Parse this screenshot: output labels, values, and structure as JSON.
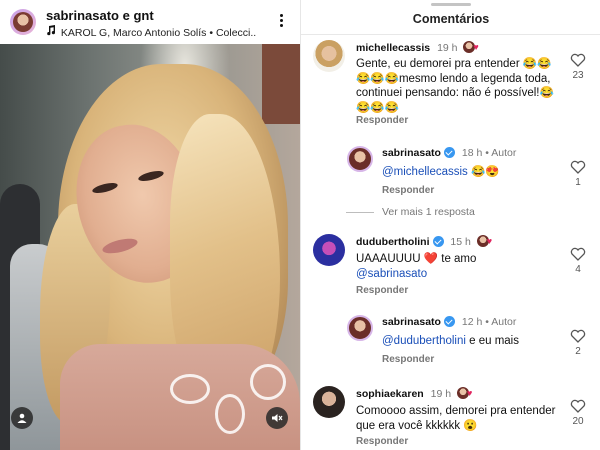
{
  "post": {
    "author": "sabrinasato",
    "conjunction": "e",
    "coauthor": "gnt",
    "music": "KAROL G, Marco Antonio Solís • Colecci..."
  },
  "comments_panel": {
    "title": "Comentários",
    "view_more": "Ver mais 1 resposta",
    "items": [
      {
        "user": "michellecassis",
        "time": "19 h",
        "text": "Gente, eu demorei pra entender 😂😂😂😂😂mesmo lendo a legenda toda, continuei pensando: não é possível!😂😂😂😂",
        "reply_label": "Responder",
        "likes": "23"
      },
      {
        "user": "sabrinasato",
        "time": "18 h",
        "author_tag": "• Autor",
        "mention": "@michellecassis",
        "text": " 😂😍",
        "reply_label": "Responder",
        "likes": "1"
      },
      {
        "user": "dudubertholini",
        "time": "15 h",
        "text": "UAAAUUUU ❤️ te amo",
        "mention": "@sabrinasato",
        "reply_label": "Responder",
        "likes": "4"
      },
      {
        "user": "sabrinasato",
        "time": "12 h",
        "author_tag": "• Autor",
        "mention": "@dudubertholini",
        "text": " e eu mais",
        "reply_label": "Responder",
        "likes": "2"
      },
      {
        "user": "sophiaekaren",
        "time": "19 h",
        "text": "Comoooo assim, demorei pra entender que era você kkkkkk 😮",
        "reply_label": "Responder",
        "likes": "20"
      }
    ]
  },
  "colors": {
    "mention": "#1a4fb8",
    "verified": "#3897f0",
    "heart_badge": "#e0245e"
  },
  "icons": [
    "music-note-icon",
    "more-options-icon",
    "user-tag-icon",
    "mute-icon",
    "heart-icon",
    "verified-icon"
  ]
}
